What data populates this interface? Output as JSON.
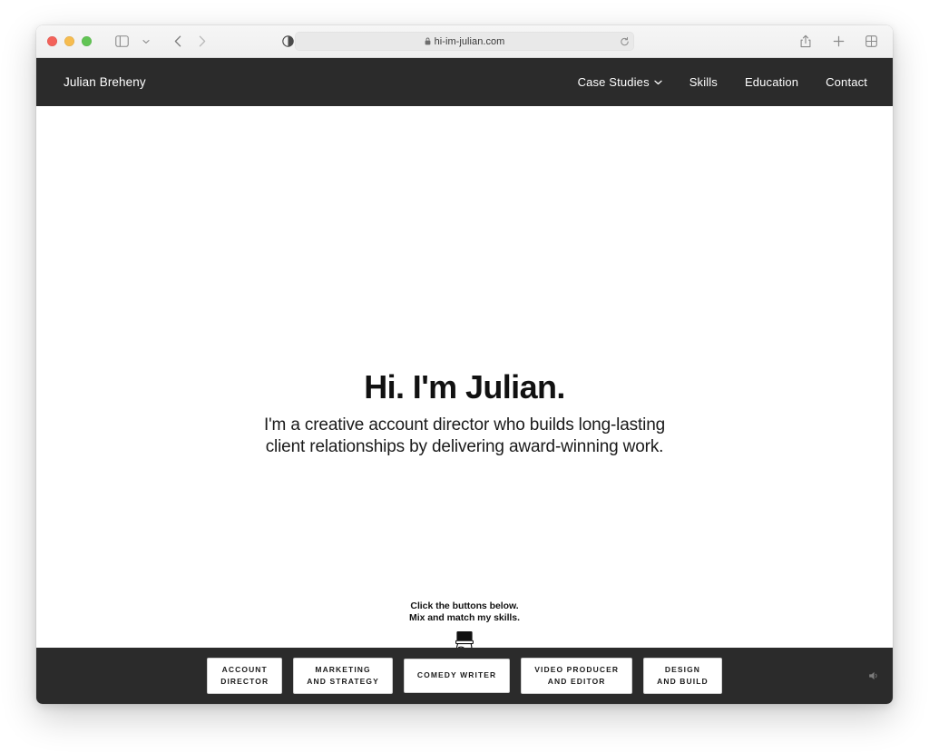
{
  "browser": {
    "traffic_lights": [
      "close",
      "minimize",
      "maximize"
    ],
    "url": "hi-im-julian.com",
    "secure": true,
    "toolbar_icons": [
      "sidebar-icon",
      "chevron-down-icon",
      "back-icon",
      "forward-icon",
      "reader-icon",
      "reload-icon",
      "share-icon",
      "new-tab-icon",
      "tab-overview-icon"
    ]
  },
  "site": {
    "brand": "Julian Breheny",
    "nav": [
      {
        "label": "Case Studies",
        "has_dropdown": true
      },
      {
        "label": "Skills",
        "has_dropdown": false
      },
      {
        "label": "Education",
        "has_dropdown": false
      },
      {
        "label": "Contact",
        "has_dropdown": false
      }
    ],
    "hero": {
      "title": "Hi. I'm Julian.",
      "subtitle_line1": "I'm a creative account director who builds long-lasting",
      "subtitle_line2": "client relationships by delivering award-winning work."
    },
    "cta": {
      "line1": "Click the buttons below.",
      "line2": "Mix and match my skills.",
      "icon": "pointing-hand-down-icon"
    },
    "skill_buttons": [
      {
        "line1": "ACCOUNT",
        "line2": "DIRECTOR"
      },
      {
        "line1": "MARKETING",
        "line2": "AND STRATEGY"
      },
      {
        "line1": "COMEDY WRITER",
        "line2": ""
      },
      {
        "line1": "VIDEO PRODUCER",
        "line2": "AND EDITOR"
      },
      {
        "line1": "DESIGN",
        "line2": "AND BUILD"
      }
    ],
    "corner_icon": "sound-icon"
  },
  "colors": {
    "nav_dark": "#2b2b2b",
    "page_bg": "#ffffff",
    "text_dark": "#111111",
    "button_bg": "#ffffff"
  }
}
